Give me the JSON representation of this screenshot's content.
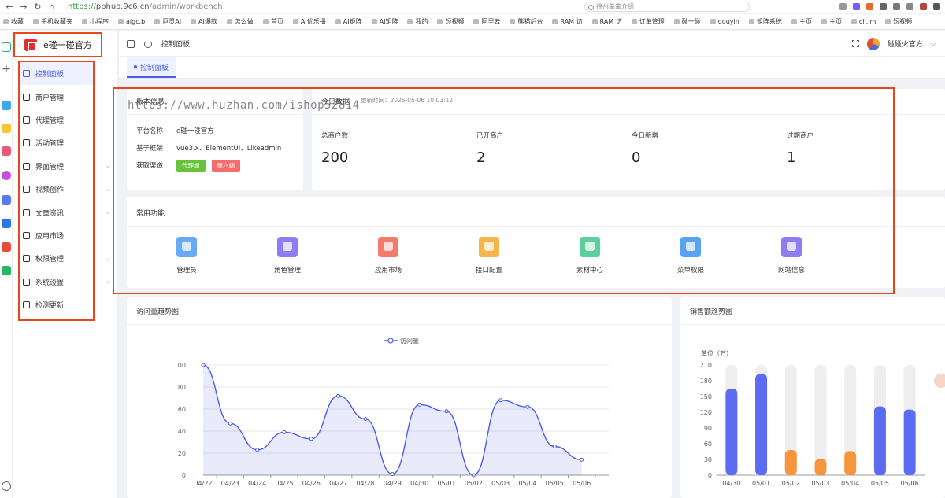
{
  "browser": {
    "url_scheme": "https://",
    "url_host": "pphuo.9c6.cn",
    "url_path": "/admin/workbench",
    "search_placeholder": "徐州拳拿介绍"
  },
  "bookmarks": [
    "收藏",
    "手机收藏夹",
    "小程序",
    "aigc.b",
    "巨灵AI",
    "AI爆款",
    "怎么做",
    "首页",
    "AI优乐播",
    "AI矩阵",
    "AI矩阵",
    "我的",
    "短视频",
    "阿里云",
    "熊猫后台",
    "RAM 访",
    "RAM 访",
    "订单管理",
    "碰一碰",
    "douyin",
    "矩阵系统",
    "主页",
    "主页",
    "cli.im",
    "短视频"
  ],
  "sidebar": {
    "brand": "e碰一碰官方",
    "items": [
      {
        "label": "控制面板",
        "active": true,
        "expandable": false
      },
      {
        "label": "商户管理",
        "active": false,
        "expandable": false
      },
      {
        "label": "代理管理",
        "active": false,
        "expandable": false
      },
      {
        "label": "活动管理",
        "active": false,
        "expandable": false
      },
      {
        "label": "界面管理",
        "active": false,
        "expandable": true
      },
      {
        "label": "视频创作",
        "active": false,
        "expandable": true
      },
      {
        "label": "文章资讯",
        "active": false,
        "expandable": true
      },
      {
        "label": "应用市场",
        "active": false,
        "expandable": false
      },
      {
        "label": "权限管理",
        "active": false,
        "expandable": true
      },
      {
        "label": "系统设置",
        "active": false,
        "expandable": true
      },
      {
        "label": "检测更新",
        "active": false,
        "expandable": false
      }
    ]
  },
  "topbar": {
    "breadcrumb": "控制面板",
    "user": "碰碰火官方"
  },
  "tabs": [
    {
      "label": "控制面板"
    }
  ],
  "watermark": "https://www.huzhan.com/ishop52814",
  "version": {
    "title": "版本信息",
    "platform_label": "平台名称",
    "platform_value": "e碰一碰官方",
    "framework_label": "基于框架",
    "framework_value": "vue3.x、ElementUI、Likeadmin",
    "channel_label": "获取渠道",
    "channel_badges": [
      {
        "label": "代理端",
        "color": "#67c23a"
      },
      {
        "label": "商户端",
        "color": "#f56c6c"
      }
    ]
  },
  "today": {
    "title": "今日数据",
    "updated": "更新时间：2025-05-06 10:03:12",
    "stats": [
      {
        "label": "总商户数",
        "value": "200"
      },
      {
        "label": "已开商户",
        "value": "2"
      },
      {
        "label": "今日新增",
        "value": "0"
      },
      {
        "label": "过期商户",
        "value": "1"
      }
    ]
  },
  "functions": {
    "title": "常用功能",
    "items": [
      {
        "label": "管理员",
        "icon": "admin-icon",
        "color": "#6aa9f4"
      },
      {
        "label": "角色管理",
        "icon": "role-icon",
        "color": "#8f7cf0"
      },
      {
        "label": "应用市场",
        "icon": "market-icon",
        "color": "#f47a6a"
      },
      {
        "label": "接口配置",
        "icon": "api-icon",
        "color": "#f6b54a"
      },
      {
        "label": "素材中心",
        "icon": "material-icon",
        "color": "#5ccf9a"
      },
      {
        "label": "菜单权限",
        "icon": "menu-icon",
        "color": "#5aa2f2"
      },
      {
        "label": "网站信息",
        "icon": "site-icon",
        "color": "#8f7cf0"
      }
    ]
  },
  "visits": {
    "title": "访问量趋势图",
    "chart_data": {
      "type": "area",
      "series": [
        {
          "name": "访问量",
          "values": [
            100,
            47,
            23,
            39,
            33,
            72,
            51,
            1,
            64,
            58,
            0,
            68,
            62,
            26,
            14
          ]
        }
      ],
      "x": [
        "04/22",
        "04/23",
        "04/24",
        "04/25",
        "04/26",
        "04/27",
        "04/28",
        "04/29",
        "04/30",
        "05/01",
        "05/02",
        "05/03",
        "05/04",
        "05/05",
        "05/06"
      ],
      "ylim": [
        0,
        100
      ],
      "yticks": [
        0,
        20,
        40,
        60,
        80,
        100
      ],
      "legend": "top-center",
      "color": "#4a5cf0"
    }
  },
  "sales": {
    "title": "销售额趋势图",
    "chart_data": {
      "type": "bar",
      "categories": [
        "04/30",
        "05/01",
        "05/02",
        "05/03",
        "05/04",
        "05/05",
        "05/06"
      ],
      "values": [
        165,
        193,
        48,
        31,
        46,
        131,
        125
      ],
      "ylabel": "单位（万）",
      "ylim": [
        0,
        210
      ],
      "yticks": [
        0,
        30,
        60,
        90,
        120,
        150,
        180,
        210
      ],
      "colors": [
        "#5b6cf2",
        "#5b6cf2",
        "#f7953c",
        "#f7953c",
        "#f7953c",
        "#5b6cf2",
        "#5b6cf2"
      ],
      "background_bars": true
    }
  }
}
